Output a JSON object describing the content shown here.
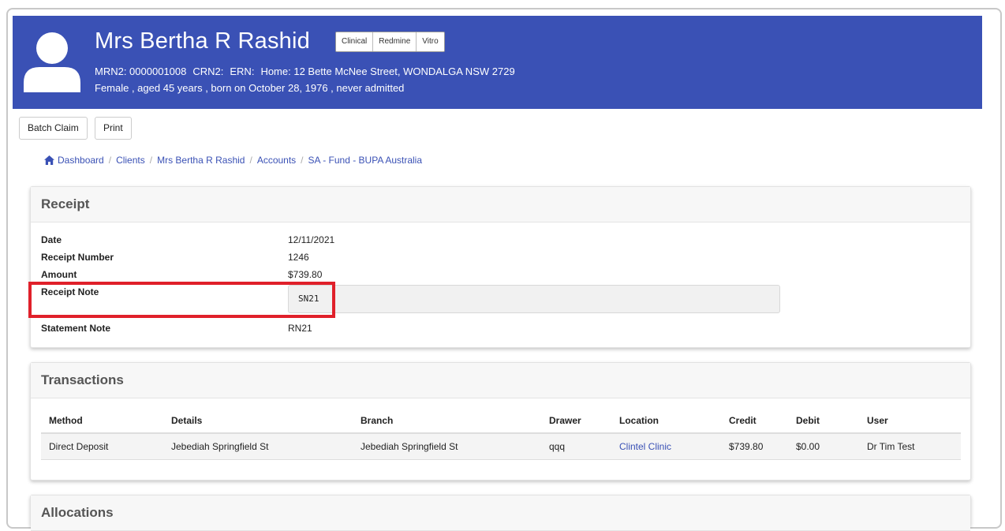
{
  "header": {
    "name": "Mrs Bertha R Rashid",
    "tags": [
      "Clinical",
      "Redmine",
      "Vitro"
    ],
    "mrn2": "MRN2: 0000001008",
    "crn2": "CRN2:",
    "ern": "ERN:",
    "home": "Home: 12 Bette McNee Street, WONDALGA NSW 2729",
    "summary": "Female , aged 45 years , born on October 28, 1976 , never admitted",
    "bg_color": "#3a51b5"
  },
  "toolbar": {
    "batch_claim": "Batch Claim",
    "print": "Print"
  },
  "breadcrumb": [
    "Dashboard",
    "Clients",
    "Mrs Bertha R Rashid",
    "Accounts",
    "SA - Fund - BUPA Australia"
  ],
  "receipt": {
    "title": "Receipt",
    "fields": {
      "date_label": "Date",
      "date_value": "12/11/2021",
      "number_label": "Receipt Number",
      "number_value": "1246",
      "amount_label": "Amount",
      "amount_value": "$739.80",
      "note_label": "Receipt Note",
      "note_value": "SN21",
      "statement_label": "Statement Note",
      "statement_value": "RN21"
    },
    "highlight_color": "#e0202a"
  },
  "transactions": {
    "title": "Transactions",
    "columns": [
      "Method",
      "Details",
      "Branch",
      "Drawer",
      "Location",
      "Credit",
      "Debit",
      "User"
    ],
    "rows": [
      [
        "Direct Deposit",
        "Jebediah Springfield St",
        "Jebediah Springfield St",
        "qqq",
        "Clintel Clinic",
        "$739.80",
        "$0.00",
        "Dr Tim Test"
      ]
    ]
  },
  "allocations": {
    "title": "Allocations"
  }
}
